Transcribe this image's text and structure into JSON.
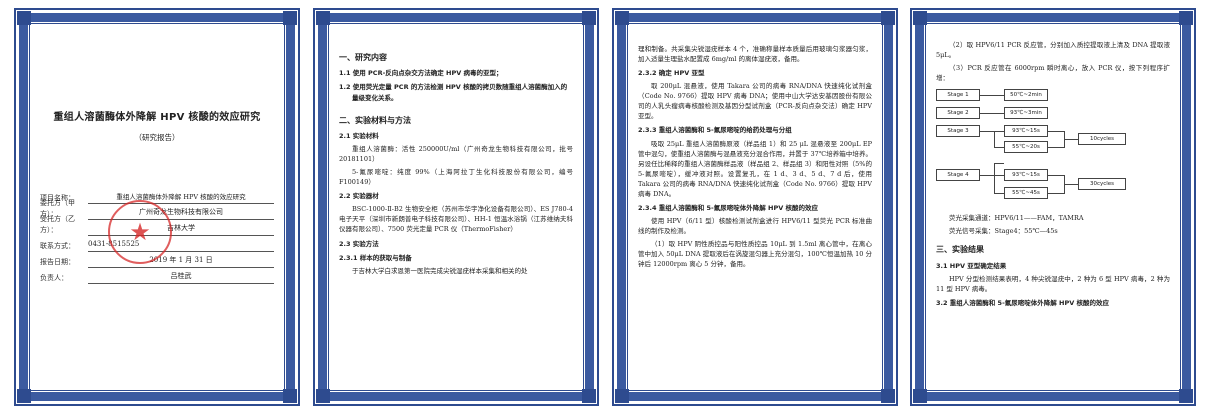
{
  "cover": {
    "title": "重组人溶菌酶体外降解 HPV 核酸的效应研究",
    "subtitle": "（研究报告）",
    "rows": [
      {
        "key": "项目名称：",
        "value": "重组人溶菌酶体外降解 HPV 核酸的效应研究"
      },
      {
        "key": "委托方（甲方）：",
        "value": "广州奇龙生物科技有限公司"
      },
      {
        "key": "受托方（乙方）：",
        "value": "吉林大学"
      },
      {
        "key": "联系方式：",
        "value": "0431-8515525"
      },
      {
        "key": "报告日期：",
        "value": "2019 年 1 月 31 日"
      },
      {
        "key": "负责人：",
        "value": "吕桂武"
      }
    ]
  },
  "page2": {
    "h1": "一、研究内容",
    "s1": "1.1 使用 PCR-反向点杂交方法确定 HPV 病毒的亚型；",
    "s2": "1.2 使用荧光定量 PCR 的方法检测 HPV 核酸的拷贝数随重组人溶菌酶加入的量级变化关系。",
    "h2": "二、实验材料与方法",
    "s21": "2.1 实验材料",
    "p1": "重组人溶菌酶：活性 250000U/ml（广州奇龙生物科技有限公司，批号 20181101）",
    "p2": "5-氟尿嘧啶：纯度 99%（上海阿拉丁生化科技股份有限公司，编号 F100149）",
    "s22": "2.2 实验器材",
    "p3": "BSC-1000-Ⅱ-B2 生物安全柜（苏州市华宇净化设备有限公司）、ES J780-4 电子天平（深圳市新朗普电子科技有限公司）、HH-1 恒温水浴锅（江苏维纳夫科仪器有限公司）、7500 荧光定量 PCR 仪（ThermoFisher）",
    "s23": "2.3 实验方法",
    "s231": "2.3.1 样本的获取与制备",
    "p4": "于吉林大学白求恩第一医院完成尖锐湿疣样本采集和相关的处"
  },
  "page3": {
    "p1": "理和制备。共采集尖锐湿疣样本 4 个，准确称量样本质量后用玻璃匀浆器匀浆，加入适量生理盐水配置成 6mg/ml 的离体湿疣液，备用。",
    "s232": "2.3.2 确定 HPV 亚型",
    "p2": "取 200μL 混悬液，使用 Takara 公司的病毒 RNA/DNA 快速纯化试剂盒（Code No. 9766）提取 HPV 病毒 DNA；使用中山大学达安基因股份有限公司的人乳头瘤病毒核酸检测及基因分型试剂盒（PCR-反向点杂交法）确定 HPV 亚型。",
    "s233": "2.3.3 重组人溶菌酶和 5-氟尿嘧啶的给药处理与分组",
    "p3": "吸取 25μL 重组人溶菌酶原液（样品组 1）和 25 μL 混悬液至 200μL EP 管中混匀，使重组人溶菌酶与混悬液充分混合作用，并置于 37℃培养箱中培养。另设任比稀释的重组人溶菌酶样品液（样品组 2、样品组 3）和阳性对照（5%的 5-氟尿嘧啶），缓冲液对照。设置复孔，在 1 d、3 d、5 d、7 d 后，使用 Takara 公司的病毒 RNA/DNA 快速纯化试剂盒（Code No. 9766）提取 HPV 病毒 DNA。",
    "s234": "2.3.4 重组人溶菌酶和 5-氟尿嘧啶体外降解 HPV 核酸的效应",
    "p4": "使用 HPV（6/11 型）核酸检测试剂盒进行 HPV6/11 型荧光 PCR 标准曲线的制作及检测。",
    "p5": "（1）取 HPV 阴性质控品与阳性质控品 10μL 到 1.5ml 离心管中，在离心管中加入 50μL DNA 提取液后在涡旋混匀器上充分混匀，100℃恒温加热 10 分钟后 12000rpm 离心 5 分钟，备用。"
  },
  "page4": {
    "p1": "（2）取 HPV6/11 PCR 反应管，分别加入质控提取液上清及 DNA 提取液 5μL。",
    "p2": "（3）PCR 反应管在 6000rpm 瞬时离心，放入 PCR 仪，按下列程序扩增：",
    "stages": [
      "Stage 1",
      "Stage 2",
      "Stage 3",
      "Stage 4"
    ],
    "steps": [
      "50℃~2min",
      "93℃~3min",
      "93℃~15s",
      "55℃~20s",
      "93℃~15s",
      "55℃~45s"
    ],
    "cycles": [
      "10cycles",
      "30cycles"
    ],
    "p3": "荧光采集通道：HPV6/11——FAM，TAMRA",
    "p4": "荧光信号采集：Stage4：55℃—45s",
    "h3": "三、实验结果",
    "s31": "3.1  HPV 亚型确定结果",
    "p5": "HPV 分型检测结果表明，4 种尖锐湿疣中，2 种为 6 型 HPV 病毒，2 种为 11 型 HPV 病毒。",
    "s32": "3.2 重组人溶菌酶和 5-氟尿嘧啶体外降解 HPV 核酸的效应"
  }
}
